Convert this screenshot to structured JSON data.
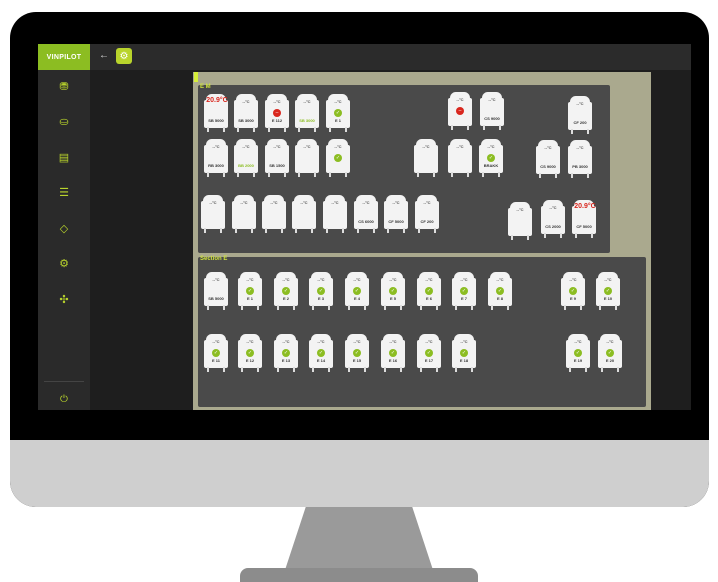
{
  "app": {
    "brand": "VINPILOT",
    "back_icon": "arrow-left-icon",
    "settings_icon": "gear-icon"
  },
  "colors": {
    "accent": "#8cbd22",
    "alert": "#d9271e",
    "workspace": "#aaa98e",
    "section": "#4a4a4a"
  },
  "sidebar": {
    "items": [
      {
        "icon": "tanks-icon",
        "glyph": "⛃"
      },
      {
        "icon": "wine-icon",
        "glyph": "⛀"
      },
      {
        "icon": "barrel-icon",
        "glyph": "▤"
      },
      {
        "icon": "tasks-icon",
        "glyph": "☰"
      },
      {
        "icon": "bucket-icon",
        "glyph": "◇"
      },
      {
        "icon": "settings-icon",
        "glyph": "⚙"
      },
      {
        "icon": "fan-icon",
        "glyph": "✣"
      }
    ],
    "power_icon": "power-icon",
    "power_glyph": "⏻"
  },
  "sections": [
    {
      "title": "E M"
    },
    {
      "title": "Section E"
    }
  ],
  "tanks": [
    {
      "big": "20.9°C",
      "label": "SB 5000",
      "sub": "",
      "state": ""
    },
    {
      "temp": "--°C",
      "label": "SB 3000",
      "sub": "",
      "state": ""
    },
    {
      "temp": "--°C",
      "label": "E 112",
      "sub": "",
      "state": "red"
    },
    {
      "temp": "--°C",
      "label": "SB 3000",
      "sub": "",
      "state": "green-label"
    },
    {
      "temp": "--°C",
      "label": "E 1",
      "sub": "",
      "state": "ok"
    },
    {
      "temp": "--°C",
      "label": "",
      "sub": "",
      "state": "red"
    },
    {
      "temp": "--°C",
      "label": "CS 9000",
      "sub": "",
      "state": ""
    },
    {
      "temp": "--°C",
      "label": "CF 200",
      "sub": "",
      "state": ""
    },
    {
      "temp": "--°C",
      "label": "RB 3000",
      "sub": "",
      "state": ""
    },
    {
      "temp": "--°C",
      "label": "BB 2000",
      "sub": "",
      "state": "green-label"
    },
    {
      "temp": "--°C",
      "label": "SB 1500",
      "sub": "",
      "state": ""
    },
    {
      "temp": "--°C",
      "label": "",
      "sub": "",
      "state": ""
    },
    {
      "temp": "--°C",
      "label": "",
      "sub": "",
      "state": "ok"
    },
    {
      "temp": "--°C",
      "label": "",
      "sub": "",
      "state": "red-label"
    },
    {
      "temp": "--°C",
      "label": "",
      "sub": "",
      "state": ""
    },
    {
      "temp": "--°C",
      "label": "BRAKK",
      "sub": "",
      "state": "ok"
    },
    {
      "temp": "--°C",
      "label": "CS 9000",
      "sub": "",
      "state": ""
    },
    {
      "temp": "--°C",
      "label": "PB 3000",
      "sub": "",
      "state": ""
    },
    {
      "temp": "--°C",
      "label": "",
      "sub": "",
      "state": ""
    },
    {
      "temp": "--°C",
      "label": "",
      "sub": "",
      "state": "green-label"
    },
    {
      "temp": "--°C",
      "label": "",
      "sub": "",
      "state": "green-label"
    },
    {
      "temp": "--°C",
      "label": "",
      "sub": "",
      "state": ""
    },
    {
      "temp": "--°C",
      "label": "",
      "sub": "",
      "state": ""
    },
    {
      "temp": "--°C",
      "label": "CS 6000",
      "sub": "",
      "state": ""
    },
    {
      "temp": "--°C",
      "label": "CF 5000",
      "sub": "",
      "state": ""
    },
    {
      "temp": "--°C",
      "label": "CF 200",
      "sub": "",
      "state": ""
    },
    {
      "temp": "--°C",
      "label": "",
      "sub": "",
      "state": "green-label"
    },
    {
      "temp": "--°C",
      "label": "CS 2000",
      "sub": "",
      "state": ""
    },
    {
      "big": "20.9°C",
      "label": "CF 5000",
      "sub": "",
      "state": ""
    },
    {
      "temp": "--°C",
      "label": "SB 5000",
      "sub": "",
      "state": ""
    },
    {
      "temp": "--°C",
      "label": "E 1",
      "sub": "",
      "state": "ok"
    },
    {
      "temp": "--°C",
      "label": "E 2",
      "sub": "",
      "state": "ok"
    },
    {
      "temp": "--°C",
      "label": "E 3",
      "sub": "",
      "state": "ok"
    },
    {
      "temp": "--°C",
      "label": "E 4",
      "sub": "",
      "state": "ok"
    },
    {
      "temp": "--°C",
      "label": "E 5",
      "sub": "",
      "state": "ok"
    },
    {
      "temp": "--°C",
      "label": "E 6",
      "sub": "",
      "state": "ok"
    },
    {
      "temp": "--°C",
      "label": "E 7",
      "sub": "",
      "state": "ok"
    },
    {
      "temp": "--°C",
      "label": "E 8",
      "sub": "",
      "state": "ok"
    },
    {
      "temp": "--°C",
      "label": "E 9",
      "sub": "",
      "state": "ok"
    },
    {
      "temp": "--°C",
      "label": "E 10",
      "sub": "",
      "state": "ok"
    },
    {
      "temp": "--°C",
      "label": "E 11",
      "sub": "",
      "state": "ok"
    },
    {
      "temp": "--°C",
      "label": "E 12",
      "sub": "",
      "state": "ok"
    },
    {
      "temp": "--°C",
      "label": "E 13",
      "sub": "",
      "state": "ok"
    },
    {
      "temp": "--°C",
      "label": "E 14",
      "sub": "",
      "state": "ok"
    },
    {
      "temp": "--°C",
      "label": "E 15",
      "sub": "",
      "state": "ok"
    },
    {
      "temp": "--°C",
      "label": "E 16",
      "sub": "",
      "state": "ok"
    },
    {
      "temp": "--°C",
      "label": "E 17",
      "sub": "",
      "state": "ok"
    },
    {
      "temp": "--°C",
      "label": "E 18",
      "sub": "",
      "state": "ok"
    },
    {
      "temp": "--°C",
      "label": "E 19",
      "sub": "",
      "state": "ok"
    },
    {
      "temp": "--°C",
      "label": "E 20",
      "sub": "",
      "state": "ok"
    },
    {
      "temp": "--°C",
      "label": "E 21",
      "sub": "",
      "state": "ok"
    }
  ]
}
